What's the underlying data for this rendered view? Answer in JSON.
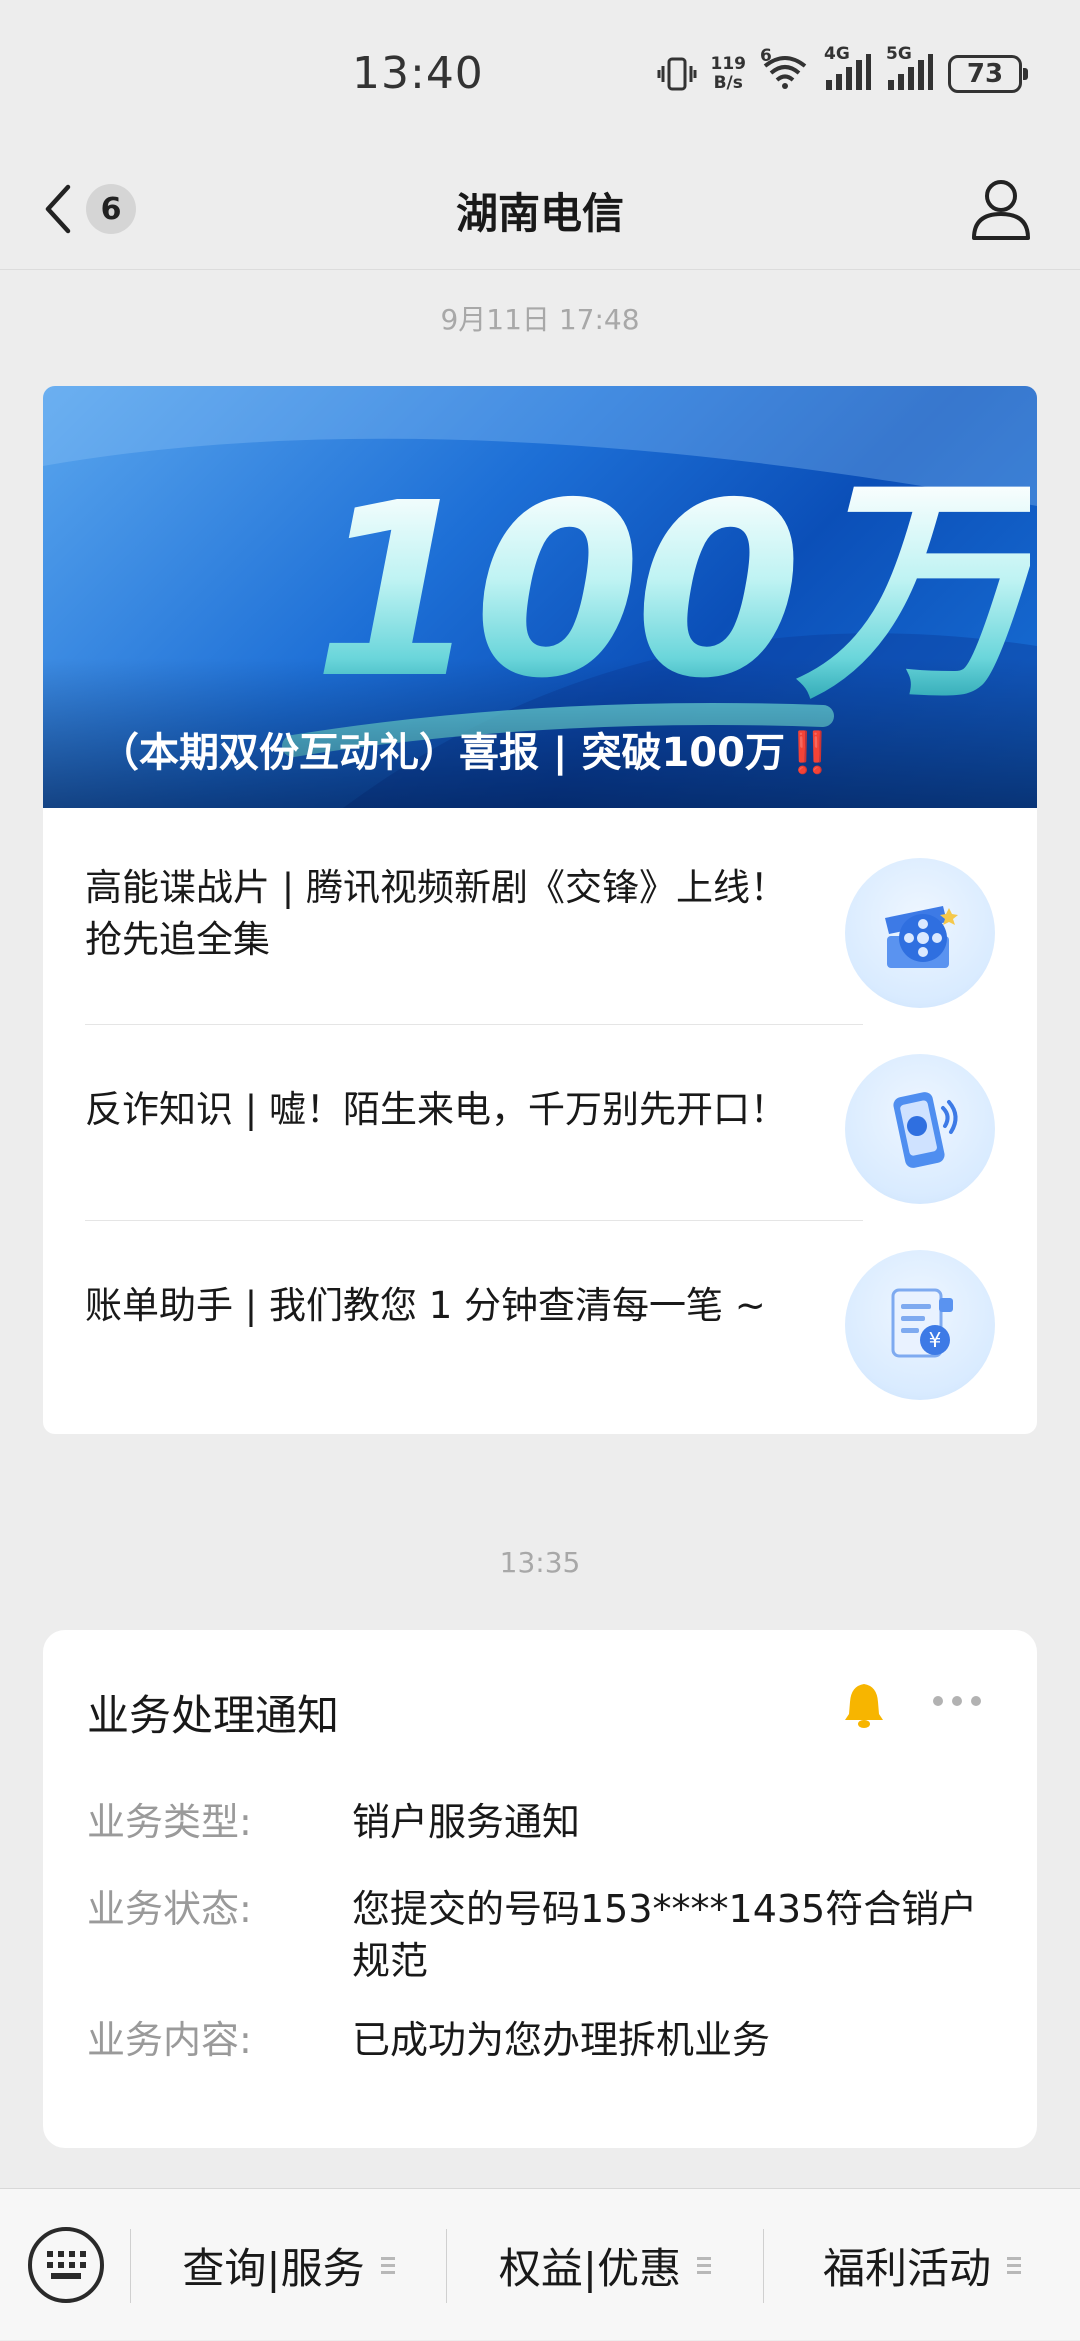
{
  "status_bar": {
    "time": "13:40",
    "net_speed_value": "119",
    "net_speed_unit": "B/s",
    "wifi_badge": "6",
    "sim1_label": "4G",
    "sim2_label": "5G",
    "battery": "73"
  },
  "nav": {
    "title": "湖南电信",
    "unread_count": "6"
  },
  "timestamps": {
    "first": "9月11日 17:48",
    "second": "13:35"
  },
  "article_card": {
    "banner_text": "100万",
    "banner_title": "（本期双份互动礼）喜报 | 突破100万",
    "banner_title_emphasis": "‼️",
    "items": [
      {
        "text": "高能谍战片 | 腾讯视频新剧《交锋》上线！抢先追全集",
        "icon": "film-reel-icon"
      },
      {
        "text": "反诈知识 | 嘘！陌生来电，千万别先开口！",
        "icon": "phone-call-icon"
      },
      {
        "text": "账单助手 | 我们教您 1 分钟查清每一笔 ~",
        "icon": "bill-receipt-icon"
      }
    ]
  },
  "notice": {
    "title": "业务处理通知",
    "accent_color": "#f7b500",
    "rows": [
      {
        "label": "业务类型:",
        "value": "销户服务通知"
      },
      {
        "label": "业务状态:",
        "value": "您提交的号码153****1435符合销户规范"
      },
      {
        "label": "业务内容:",
        "value": "已成功为您办理拆机业务"
      }
    ]
  },
  "bottom_menu": {
    "items": [
      {
        "label": "查询|服务"
      },
      {
        "label": "权益|优惠"
      },
      {
        "label": "福利活动"
      }
    ]
  }
}
